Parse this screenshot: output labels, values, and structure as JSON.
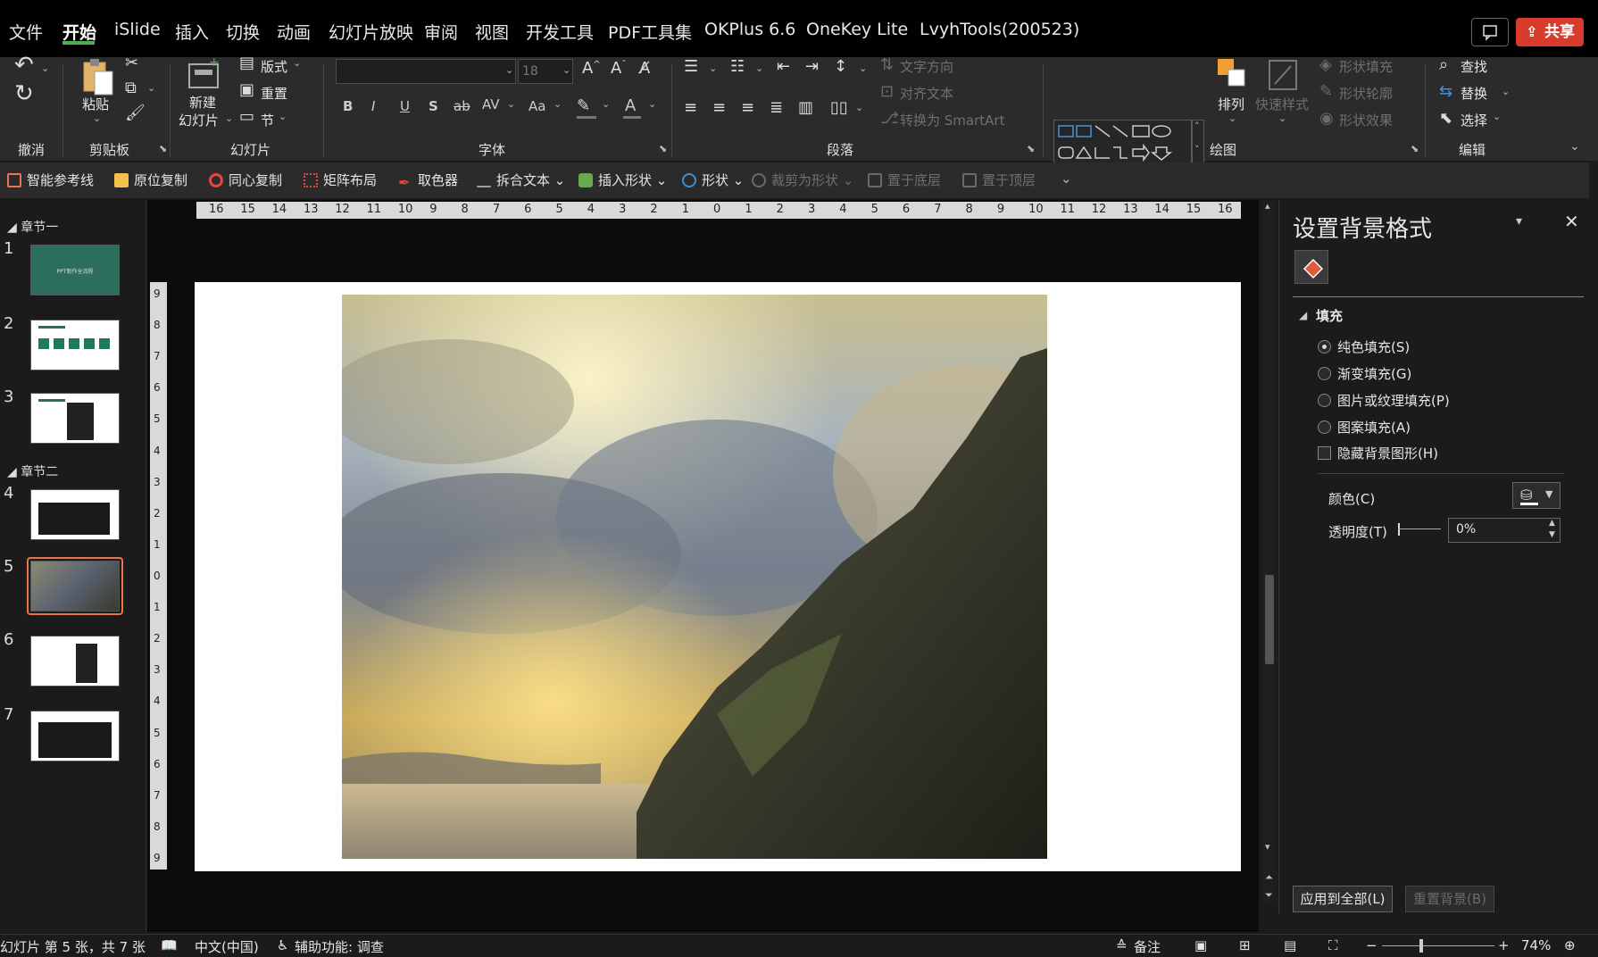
{
  "menu": {
    "items": [
      "文件",
      "开始",
      "iSlide",
      "插入",
      "切换",
      "动画",
      "幻灯片放映",
      "审阅",
      "视图",
      "开发工具",
      "PDF工具集",
      "OKPlus 6.6",
      "OneKey Lite",
      "LvyhTools(200523)"
    ],
    "active": "开始",
    "share_label": "共享"
  },
  "ribbon": {
    "groups": {
      "undo": "撤消",
      "clipboard": "剪贴板",
      "slides": "幻灯片",
      "font": "字体",
      "paragraph": "段落",
      "drawing": "绘图",
      "editing": "编辑"
    },
    "paste": "粘贴",
    "new_slide_line1": "新建",
    "new_slide_line2": "幻灯片",
    "layout": "版式",
    "reset": "重置",
    "section": "节",
    "font_name": "",
    "font_size": "18",
    "text_direction": "文字方向",
    "align_text": "对齐文本",
    "convert_smartart": "转换为 SmartArt",
    "arrange": "排列",
    "quick_styles": "快速样式",
    "shape_fill": "形状填充",
    "shape_outline": "形状轮廓",
    "shape_effects": "形状效果",
    "find": "查找",
    "replace": "替换",
    "select": "选择",
    "bold": "B",
    "italic": "I",
    "underline": "U",
    "shadow": "S",
    "strike": "ab",
    "char_spacing": "AV",
    "change_case": "Aa",
    "font_color": "A"
  },
  "quickbar": {
    "items": [
      {
        "label": "智能参考线",
        "color": "#e8754c"
      },
      {
        "label": "原位复制",
        "color": "#f2c14e"
      },
      {
        "label": "同心复制",
        "color": "#e8453c"
      },
      {
        "label": "矩阵布局",
        "color": "#e8453c"
      },
      {
        "label": "取色器",
        "color": "#e8453c"
      },
      {
        "label": "拆合文本",
        "color": "#9e9e9e"
      },
      {
        "label": "插入形状",
        "color": "#6aa84f"
      },
      {
        "label": "形状",
        "color": "#3f8fd2"
      },
      {
        "label": "裁剪为形状",
        "color": "#6a6a6a",
        "disabled": true
      },
      {
        "label": "置于底层",
        "color": "#6a6a6a",
        "disabled": true
      },
      {
        "label": "置于顶层",
        "color": "#6a6a6a",
        "disabled": true
      }
    ]
  },
  "thumbnails": {
    "sections": [
      "章节一",
      "章节二"
    ],
    "slides": [
      "1",
      "2",
      "3",
      "4",
      "5",
      "6",
      "7"
    ],
    "thumb1_title": "PPT制作全流程"
  },
  "ruler": {
    "h_ticks": [
      "16",
      "15",
      "14",
      "13",
      "12",
      "11",
      "10",
      "9",
      "8",
      "7",
      "6",
      "5",
      "4",
      "3",
      "2",
      "1",
      "0",
      "1",
      "2",
      "3",
      "4",
      "5",
      "6",
      "7",
      "8",
      "9",
      "10",
      "11",
      "12",
      "13",
      "14",
      "15",
      "16"
    ],
    "v_ticks": [
      "9",
      "8",
      "7",
      "6",
      "5",
      "4",
      "3",
      "2",
      "1",
      "0",
      "1",
      "2",
      "3",
      "4",
      "5",
      "6",
      "7",
      "8",
      "9"
    ]
  },
  "format_pane": {
    "title": "设置背景格式",
    "section_fill": "填充",
    "options": [
      {
        "label": "纯色填充(S)",
        "selected": true
      },
      {
        "label": "渐变填充(G)",
        "selected": false
      },
      {
        "label": "图片或纹理填充(P)",
        "selected": false
      },
      {
        "label": "图案填充(A)",
        "selected": false
      }
    ],
    "hide_bg_graphics": "隐藏背景图形(H)",
    "color_label": "颜色(C)",
    "transparency_label": "透明度(T)",
    "transparency_value": "0%",
    "apply_all": "应用到全部(L)",
    "reset_bg": "重置背景(B)"
  },
  "status": {
    "slide_info": "幻灯片 第 5 张，共 7 张",
    "language": "中文(中国)",
    "accessibility": "辅助功能: 调查",
    "notes": "备注",
    "zoom": "74%",
    "minus": "−",
    "plus": "+"
  }
}
